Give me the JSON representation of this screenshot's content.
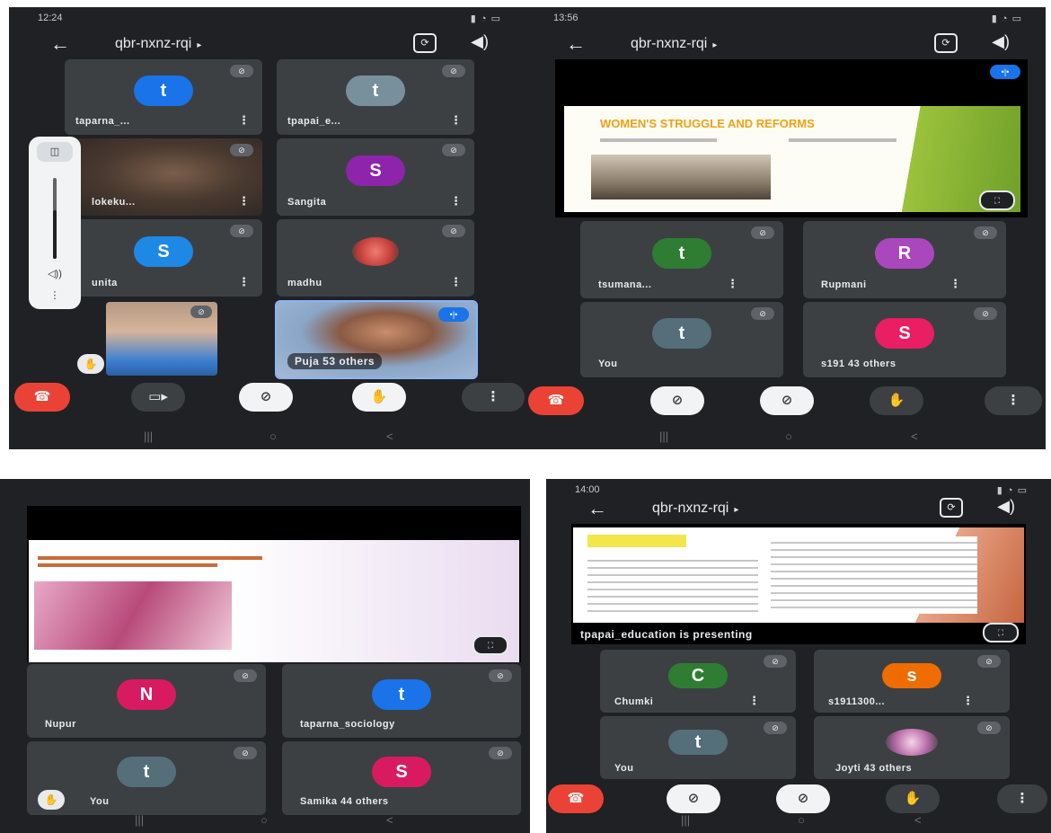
{
  "meeting": {
    "title": "qbr-nxnz-rqi"
  },
  "icons": {
    "back": "back-arrow-icon",
    "camera_flip": "camera-switch-icon",
    "speaker": "speaker-icon",
    "mute": "mic-off-icon",
    "raise_hand": "raise-hand-icon",
    "more": "more-vert-icon",
    "fullscreen": "fullscreen-icon"
  },
  "colors": {
    "end_call": "#ea4335",
    "background": "#202124",
    "tile": "#3c4043",
    "speaking": "#1a73e8"
  },
  "screen1": {
    "status_time": "12:24",
    "tiles": [
      {
        "name": "taparna_...",
        "avatar": "t",
        "color": "#1a73e8"
      },
      {
        "name": "tpapai_e...",
        "avatar": "t",
        "color": "#78909c"
      },
      {
        "name": "lokeku...",
        "avatar": "",
        "color": ""
      },
      {
        "name": "Sangita",
        "avatar": "S",
        "color": "#8e24aa"
      },
      {
        "name": "unita",
        "avatar": "S",
        "color": "#1e88e5"
      },
      {
        "name": "madhu",
        "avatar": "",
        "color": ""
      }
    ],
    "others_label": "Puja  53 others"
  },
  "screen2": {
    "status_time": "13:56",
    "slide_title": "WOMEN'S STRUGGLE AND REFORMS",
    "tiles": [
      {
        "name": "tsumana...",
        "avatar": "t",
        "color": "#2e7d32"
      },
      {
        "name": "Rupmani",
        "avatar": "R",
        "color": "#ab47bc"
      },
      {
        "name": "You",
        "avatar": "t",
        "color": "#546e7a"
      },
      {
        "name": "s191  43 others",
        "avatar": "S",
        "color": "#e91e63"
      }
    ]
  },
  "screen3": {
    "tiles": [
      {
        "name": "Nupur",
        "avatar": "N",
        "color": "#d81b60"
      },
      {
        "name": "taparna_sociology",
        "avatar": "t",
        "color": "#1a73e8"
      },
      {
        "name": "You",
        "avatar": "t",
        "color": "#546e7a"
      },
      {
        "name": "Samika  44 others",
        "avatar": "S",
        "color": "#d81b60"
      }
    ]
  },
  "screen4": {
    "status_time": "14:00",
    "presenting": "tpapai_education is presenting",
    "tiles": [
      {
        "name": "Chumki",
        "avatar": "C",
        "color": "#2e7d32"
      },
      {
        "name": "s1911300...",
        "avatar": "s",
        "color": "#ef6c00"
      },
      {
        "name": "You",
        "avatar": "t",
        "color": "#546e7a"
      },
      {
        "name": "Joyti  43 others",
        "avatar": "",
        "color": ""
      }
    ]
  }
}
